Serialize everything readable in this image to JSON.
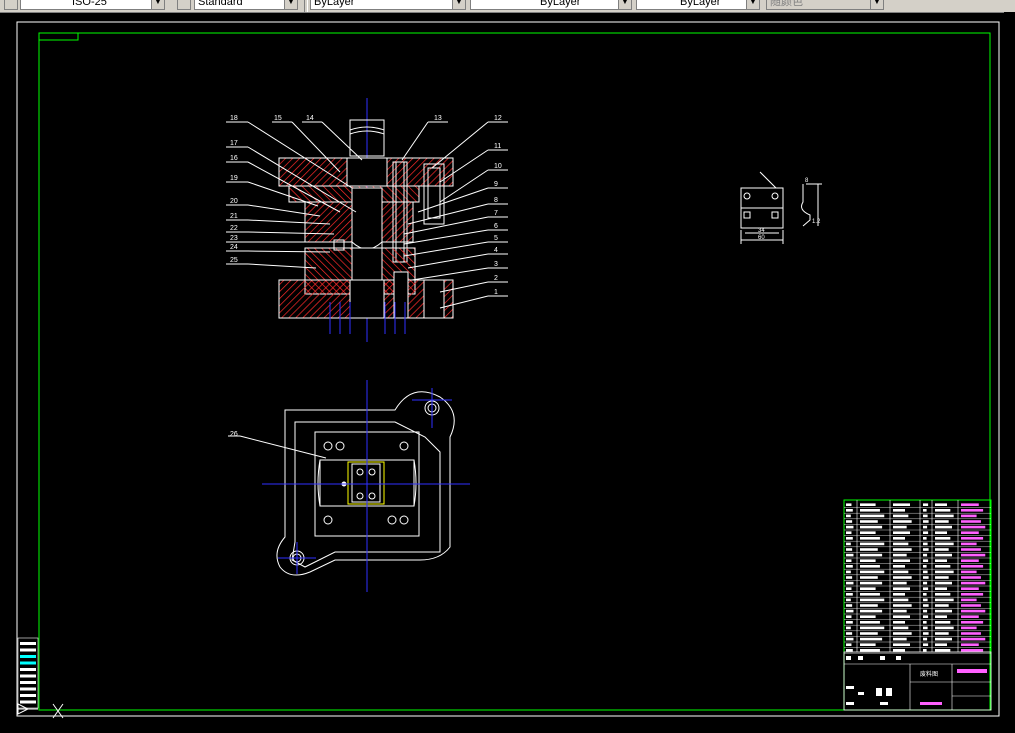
{
  "toolbar": {
    "dimstyle_value": "ISO-25",
    "textstyle_value": "Standard",
    "layer_value": "ByLayer",
    "linetype_value": "ByLayer",
    "lineweight_value": "ByLayer",
    "plotstyle_value": "随颜色"
  },
  "icons": {
    "dimstyle": "dimension-style-icon",
    "textstyle": "text-style-icon",
    "dropdown": "chevron-down-icon",
    "ucs": "ucs-icon"
  },
  "drawing": {
    "callouts_left": [
      "18",
      "17",
      "16",
      "19",
      "20",
      "21",
      "22",
      "23",
      "24",
      "25"
    ],
    "callouts_top": [
      "15",
      "14",
      "13",
      "12"
    ],
    "callouts_right": [
      "11",
      "10",
      "9",
      "8",
      "7",
      "6",
      "5",
      "4",
      "3",
      "2",
      "1"
    ],
    "plan_callout": "26",
    "part_dims": {
      "width": "60",
      "inner": "34",
      "thick": "1.2",
      "flange": "8"
    },
    "title_block_name": "废料图"
  },
  "colors": {
    "background": "#000000",
    "frame": "#00ff00",
    "hatch": "#ff2a2a",
    "centerline": "#3030ff",
    "outline": "#ffffff",
    "accent": "#00ffff",
    "magenta": "#ff60ff"
  }
}
